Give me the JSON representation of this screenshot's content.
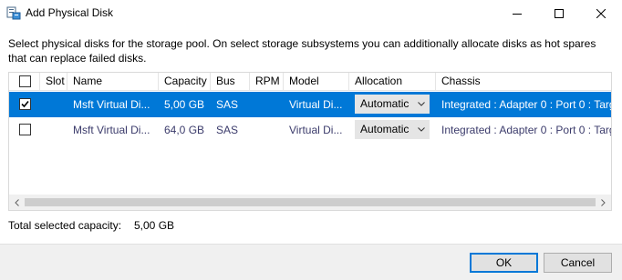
{
  "window": {
    "title": "Add Physical Disk",
    "icon": "server-manager-icon"
  },
  "instructions": "Select physical disks for the storage pool. On select storage subsystems you can additionally allocate disks as hot spares that can replace failed disks.",
  "table": {
    "columns": [
      "Slot",
      "Name",
      "Capacity",
      "Bus",
      "RPM",
      "Model",
      "Allocation",
      "Chassis"
    ],
    "rows": [
      {
        "checked": true,
        "selected": true,
        "slot": "",
        "name": "Msft Virtual Di...",
        "capacity": "5,00 GB",
        "bus": "SAS",
        "rpm": "",
        "model": "Virtual Di...",
        "allocation": "Automatic",
        "chassis": "Integrated : Adapter 0 : Port 0 : Targ"
      },
      {
        "checked": false,
        "selected": false,
        "slot": "",
        "name": "Msft Virtual Di...",
        "capacity": "64,0 GB",
        "bus": "SAS",
        "rpm": "",
        "model": "Virtual Di...",
        "allocation": "Automatic",
        "chassis": "Integrated : Adapter 0 : Port 0 : Targ"
      }
    ]
  },
  "total": {
    "label": "Total selected capacity:",
    "value": "5,00 GB"
  },
  "buttons": {
    "ok": "OK",
    "cancel": "Cancel"
  },
  "colors": {
    "selection": "#0078d7",
    "row_text": "#3b3b6b"
  }
}
